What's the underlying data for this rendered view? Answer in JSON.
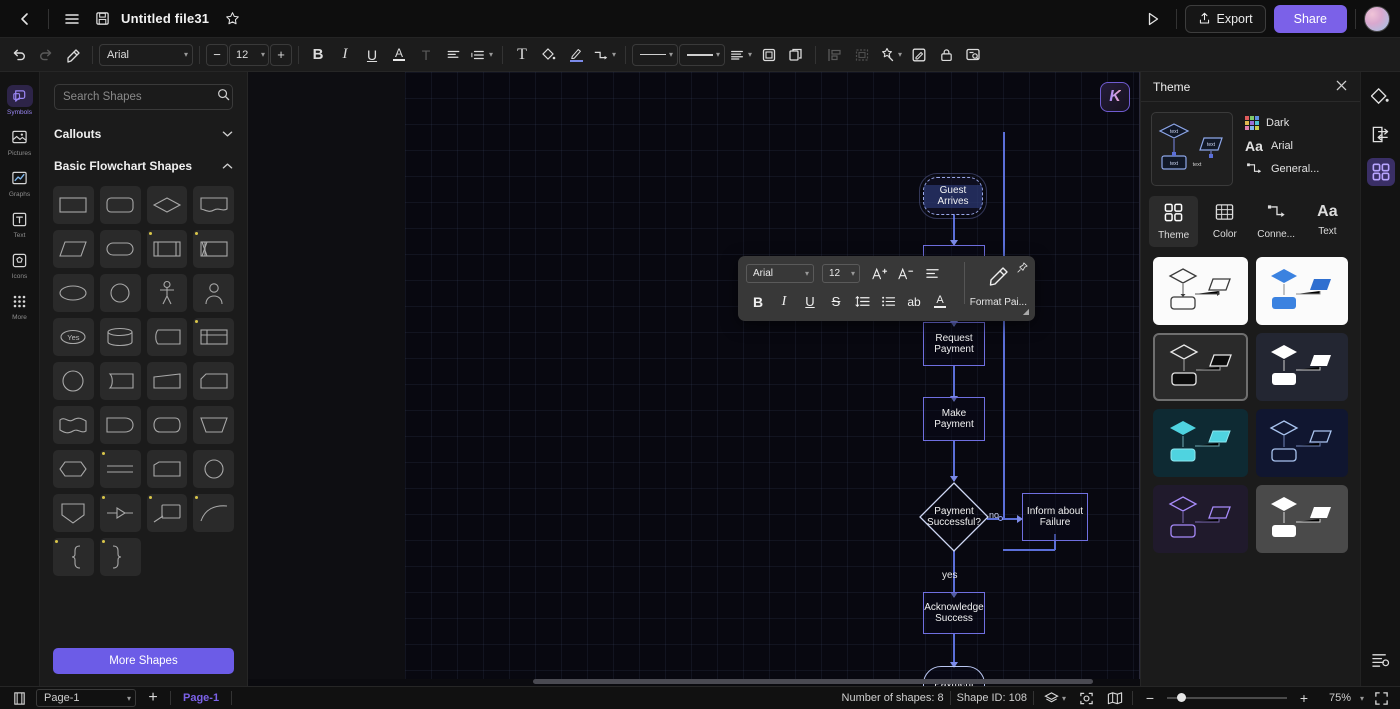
{
  "titlebar": {
    "back_icon": "chevron-left-icon",
    "menu_icon": "hamburger-menu-icon",
    "save_icon": "save-disk-icon",
    "title": "Untitled file31",
    "favorite_icon": "star-icon",
    "present_icon": "play-triangle-icon",
    "export_label": "Export",
    "share_label": "Share"
  },
  "toolbar": {
    "undo": "undo-icon",
    "redo": "redo-icon",
    "format_painter": "format-painter-icon",
    "font_family": "Arial",
    "font_size": "12",
    "decrease_label": "−",
    "increase_label": "+",
    "bold": "B",
    "italic": "I",
    "underline": "U",
    "font_color": "A",
    "text_effect": "T",
    "align": "align-left-icon",
    "line_spacing": "line-spacing-icon",
    "insert_text": "T",
    "fill_color": "fill-bucket-icon",
    "line_color": "brush-icon",
    "connector": "connector-icon",
    "line_style_1": "line-style-dropdown",
    "line_style_2": "line-weight-dropdown",
    "layers": "layers-icon",
    "duplicate": "duplicate-icon",
    "copy": "copy-icon",
    "align_objects": "align-objects-icon",
    "group": "group-icon",
    "magic": "magic-wand-icon",
    "edit": "edit-pencil-icon",
    "lock": "lock-icon",
    "comment": "comment-search-icon"
  },
  "left_rail": {
    "items": [
      {
        "label": "Symbols",
        "icon": "symbols-icon",
        "active": true
      },
      {
        "label": "Pictures",
        "icon": "picture-icon",
        "active": false
      },
      {
        "label": "Graphs",
        "icon": "graph-line-icon",
        "active": false
      },
      {
        "label": "Text",
        "icon": "text-box-icon",
        "active": false
      },
      {
        "label": "Icons",
        "icon": "icons-icon",
        "active": false
      },
      {
        "label": "More",
        "icon": "more-grid-icon",
        "active": false
      }
    ]
  },
  "shapes_panel": {
    "search_placeholder": "Search Shapes",
    "search_value": "",
    "search_icon": "search-icon",
    "groups": [
      {
        "label": "Callouts",
        "expanded": false,
        "chevron": "chevron-down-icon"
      },
      {
        "label": "Basic Flowchart Shapes",
        "expanded": true,
        "chevron": "chevron-up-icon"
      }
    ],
    "shape_cells": [
      {
        "name": "process-rect",
        "badge": false
      },
      {
        "name": "rounded-rect",
        "badge": false
      },
      {
        "name": "decision-diamond",
        "badge": false
      },
      {
        "name": "document-wave",
        "badge": false
      },
      {
        "name": "parallelogram-data",
        "badge": false
      },
      {
        "name": "terminator-stadium",
        "badge": false
      },
      {
        "name": "predefined-process",
        "badge": true
      },
      {
        "name": "internal-storage",
        "badge": true
      },
      {
        "name": "ellipse",
        "badge": false
      },
      {
        "name": "circle",
        "badge": false
      },
      {
        "name": "actor-person",
        "badge": false
      },
      {
        "name": "user-bust",
        "badge": false
      },
      {
        "name": "yes-oval",
        "badge": false,
        "text": "Yes"
      },
      {
        "name": "cylinder-database",
        "badge": false
      },
      {
        "name": "card-shape",
        "badge": false
      },
      {
        "name": "table-shape",
        "badge": true
      },
      {
        "name": "circle-outline",
        "badge": false
      },
      {
        "name": "stored-data",
        "badge": false
      },
      {
        "name": "trapezoid-slant",
        "badge": false
      },
      {
        "name": "cut-corner-rect",
        "badge": false
      },
      {
        "name": "wave-shape",
        "badge": false
      },
      {
        "name": "delay-shape",
        "badge": false
      },
      {
        "name": "display-shape",
        "badge": false
      },
      {
        "name": "manual-operation",
        "badge": false
      },
      {
        "name": "hexagon-preparation",
        "badge": false
      },
      {
        "name": "parallel-lines",
        "badge": true
      },
      {
        "name": "manual-input",
        "badge": false
      },
      {
        "name": "connector-circle",
        "badge": false
      },
      {
        "name": "extract-pentagon",
        "badge": false
      },
      {
        "name": "merge-arrow",
        "badge": true
      },
      {
        "name": "annotation-note",
        "badge": true
      },
      {
        "name": "curve-arc",
        "badge": true
      },
      {
        "name": "left-brace",
        "badge": true
      },
      {
        "name": "right-brace",
        "badge": true
      }
    ],
    "more_shapes_label": "More Shapes"
  },
  "float_format": {
    "font_family": "Arial",
    "font_size": "12",
    "increase_font": "A+",
    "decrease_font": "A-",
    "align": "align-icon",
    "bold": "B",
    "italic": "I",
    "underline": "U",
    "strikethrough": "S",
    "line_spacing": "line-spacing-icon",
    "bullets": "bullet-list-icon",
    "highlight": "ab",
    "font_color": "A",
    "format_painter_label": "Format Pai...",
    "format_painter_icon": "format-painter-icon",
    "pin_icon": "pin-icon"
  },
  "canvas": {
    "logo": "K",
    "zoom_percent": "75%",
    "nodes": [
      {
        "id": "start",
        "label": "Guest Arrives",
        "type": "terminator-dashed"
      },
      {
        "id": "n2",
        "label": "",
        "type": "process"
      },
      {
        "id": "request",
        "label": "Request Payment",
        "type": "process"
      },
      {
        "id": "make",
        "label": "Make Payment",
        "type": "process"
      },
      {
        "id": "decide",
        "label": "Payment Successful?",
        "type": "decision"
      },
      {
        "id": "failure",
        "label": "Inform about Failure",
        "type": "process"
      },
      {
        "id": "ack",
        "label": "Acknowledge Success",
        "type": "process"
      },
      {
        "id": "end",
        "label": "Payment Completed",
        "type": "terminator"
      }
    ],
    "edge_labels": [
      {
        "id": "yes",
        "text": "yes"
      },
      {
        "id": "no",
        "text": "no"
      }
    ]
  },
  "theme_panel": {
    "title": "Theme",
    "close_icon": "close-icon",
    "preview_icon": "theme-preview-diagram",
    "properties": [
      {
        "label": "Dark",
        "icon": "color-swatches-icon"
      },
      {
        "label": "Arial",
        "icon": "font-aa-icon"
      },
      {
        "label": "General...",
        "icon": "connector-icon"
      }
    ],
    "tabs": [
      {
        "label": "Theme",
        "icon": "theme-grid-icon",
        "active": true
      },
      {
        "label": "Color",
        "icon": "color-table-icon",
        "active": false
      },
      {
        "label": "Conne...",
        "icon": "connector-icon",
        "active": false
      },
      {
        "label": "Text",
        "icon": "font-aa-icon",
        "active": false
      }
    ],
    "theme_cards": [
      {
        "name": "theme-white-outline",
        "bg": "#fbfbfb",
        "stroke": "#3b3b3b",
        "fill": "none",
        "selected": false
      },
      {
        "name": "theme-white-blue",
        "bg": "#fbfbfb",
        "stroke": "#2f6fd0",
        "fill": "#3b82e0",
        "selected": false
      },
      {
        "name": "theme-dark-outline",
        "bg": "#2a2a2a",
        "stroke": "#e8e8e8",
        "fill": "none",
        "selected": true
      },
      {
        "name": "theme-navy-white",
        "bg": "#232632",
        "stroke": "#ffffff",
        "fill": "#ffffff",
        "selected": false
      },
      {
        "name": "theme-teal-fill",
        "bg": "#0e2a33",
        "stroke": "#4fd3e0",
        "fill": "#4fd3e0",
        "selected": false
      },
      {
        "name": "theme-navy-outline",
        "bg": "#101630",
        "stroke": "#a9c4ef",
        "fill": "none",
        "selected": false
      },
      {
        "name": "theme-purple-outline",
        "bg": "#201a2c",
        "stroke": "#a78bfa",
        "fill": "none",
        "selected": false
      },
      {
        "name": "theme-grey-white",
        "bg": "#4a4a4a",
        "stroke": "#ffffff",
        "fill": "#ffffff",
        "selected": false
      }
    ]
  },
  "right_rail": {
    "items": [
      {
        "name": "fill-bucket-icon",
        "active": false
      },
      {
        "name": "swap-panel-icon",
        "active": false
      },
      {
        "name": "theme-grid-icon",
        "active": true
      }
    ],
    "bottom_icon": "settings-list-icon"
  },
  "statusbar": {
    "page_icon": "page-setup-icon",
    "page_select": "Page-1",
    "add_page": "+",
    "page_tab": "Page-1",
    "shape_count": "Number of shapes: 8",
    "shape_id": "Shape ID: 108",
    "layers_icon": "layers-icon",
    "focus_icon": "focus-icon",
    "map_icon": "mini-map-icon",
    "zoom_out": "−",
    "zoom_in": "+",
    "zoom_level": "75%",
    "fullscreen_icon": "fullscreen-icon"
  },
  "colors": {
    "accent": "#7b61e8",
    "node_stroke": "#6f6fe0",
    "connector": "#5b6fd8",
    "canvas_bg": "#080810"
  }
}
